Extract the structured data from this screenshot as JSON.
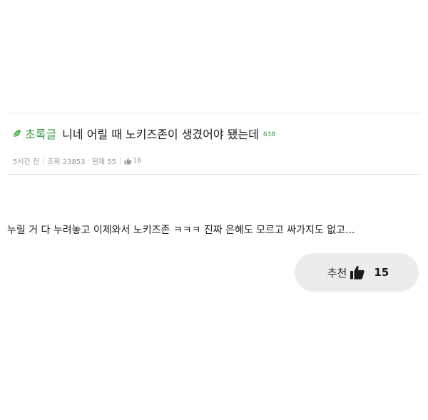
{
  "post": {
    "board_name": "초록글",
    "title": "니네 어릴 때 노키즈존이 생겼어야 됐는데",
    "comment_count": "638",
    "icon_board": "leaf-icon",
    "meta": {
      "time": "5시간 전",
      "views": "조회 23853",
      "current": "현재 55",
      "likes": "16"
    },
    "body": "누릴 거 다 누려놓고 이제와서 노키즈존 ㅋㅋㅋ 진짜 은혜도 모르고 싸가지도 없고...",
    "recommend": {
      "label": "추천",
      "count": "15",
      "icon": "thumbs-up-icon"
    }
  },
  "colors": {
    "accent_green": "#3b9a45",
    "button_bg": "#ececec",
    "meta_text": "#9a9a9a",
    "divider": "#e6e6e6"
  }
}
